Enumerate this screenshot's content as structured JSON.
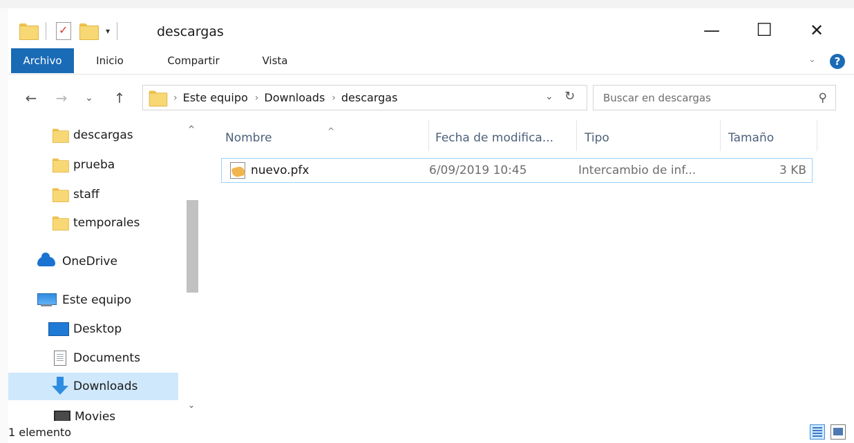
{
  "window": {
    "title": "descargas",
    "minimize_glyph": "—",
    "maximize_glyph": "☐",
    "close_glyph": "✕",
    "qat_dropdown_glyph": "▾"
  },
  "ribbon": {
    "tabs": [
      {
        "label": "Archivo"
      },
      {
        "label": "Inicio"
      },
      {
        "label": "Compartir"
      },
      {
        "label": "Vista"
      }
    ],
    "help_label": "?",
    "expand_glyph": "⌄"
  },
  "nav": {
    "back_glyph": "←",
    "forward_glyph": "→",
    "recent_glyph": "⌄",
    "up_glyph": "↑",
    "breadcrumb": [
      "Este equipo",
      "Downloads",
      "descargas"
    ],
    "crumb_sep": "›",
    "address_drop_glyph": "⌄",
    "refresh_glyph": "↻"
  },
  "search": {
    "placeholder": "Buscar en descargas",
    "icon": "search-icon",
    "icon_glyph": "⚲"
  },
  "sidebar": {
    "items": [
      {
        "label": "descargas",
        "icon": "folder-icon"
      },
      {
        "label": "prueba",
        "icon": "folder-icon"
      },
      {
        "label": "staff",
        "icon": "folder-icon"
      },
      {
        "label": "temporales",
        "icon": "folder-icon"
      },
      {
        "label": "OneDrive",
        "icon": "onedrive-cloud-icon"
      },
      {
        "label": "Este equipo",
        "icon": "this-pc-icon"
      },
      {
        "label": "Desktop",
        "icon": "desktop-icon"
      },
      {
        "label": "Documents",
        "icon": "documents-icon"
      },
      {
        "label": "Downloads",
        "icon": "downloads-icon",
        "selected": true
      },
      {
        "label": "Movies",
        "icon": "movies-icon"
      }
    ],
    "scroll_up_glyph": "^",
    "scroll_down_glyph": "⌄"
  },
  "file_list": {
    "columns": [
      "Nombre",
      "Fecha de modifica...",
      "Tipo",
      "Tamaño"
    ],
    "sort_glyph": "^",
    "rows": [
      {
        "name": "nuevo.pfx",
        "date": "6/09/2019 10:45",
        "type": "Intercambio de inf...",
        "size": "3 KB",
        "icon": "certificate-file-icon"
      }
    ]
  },
  "status": {
    "count_text": "1 elemento"
  },
  "colors": {
    "accent": "#1a6bb5",
    "selection": "#cfe8fc",
    "row_border": "#99d1ff",
    "folder": "#f8d775"
  }
}
